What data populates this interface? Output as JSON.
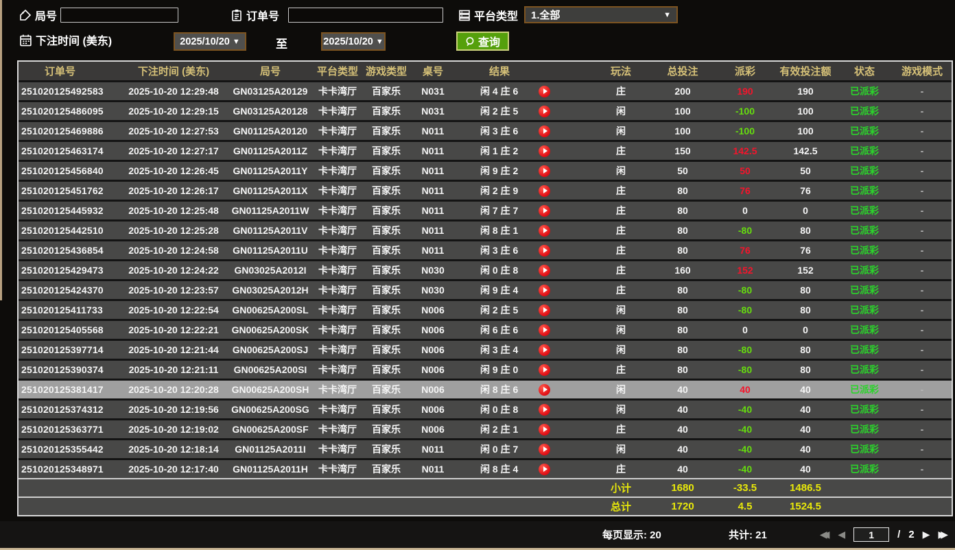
{
  "filters": {
    "round_label": "局号",
    "round_value": "",
    "order_label": "订单号",
    "order_value": "",
    "platform_label": "平台类型",
    "platform_value": "1.全部",
    "bet_time_label": "下注时间 (美东)",
    "date_from": "2025/10/20",
    "to_label": "至",
    "date_to": "2025/10/20",
    "query_label": "查询",
    "caret": "▼"
  },
  "table": {
    "columns": [
      "订单号",
      "下注时间 (美东)",
      "局号",
      "平台类型",
      "游戏类型",
      "桌号",
      "结果",
      "玩法",
      "总投注",
      "派彩",
      "有效投注额",
      "状态",
      "游戏模式"
    ],
    "selected_index": 15,
    "rows": [
      {
        "order": "251020125492583",
        "time": "2025-10-20 12:29:48",
        "round": "GN03125A20129",
        "platform": "卡卡湾厅",
        "game": "百家乐",
        "tbl": "N031",
        "result": "闲 4 庄 6",
        "side": "庄",
        "bet": "200",
        "payout": "190",
        "pc": "pos",
        "valid": "190",
        "status": "已派彩",
        "mode": "-"
      },
      {
        "order": "251020125486095",
        "time": "2025-10-20 12:29:15",
        "round": "GN03125A20128",
        "platform": "卡卡湾厅",
        "game": "百家乐",
        "tbl": "N031",
        "result": "闲 2 庄 5",
        "side": "闲",
        "bet": "100",
        "payout": "-100",
        "pc": "neg",
        "valid": "100",
        "status": "已派彩",
        "mode": "-"
      },
      {
        "order": "251020125469886",
        "time": "2025-10-20 12:27:53",
        "round": "GN01125A20120",
        "platform": "卡卡湾厅",
        "game": "百家乐",
        "tbl": "N011",
        "result": "闲 3 庄 6",
        "side": "闲",
        "bet": "100",
        "payout": "-100",
        "pc": "neg",
        "valid": "100",
        "status": "已派彩",
        "mode": "-"
      },
      {
        "order": "251020125463174",
        "time": "2025-10-20 12:27:17",
        "round": "GN01125A2011Z",
        "platform": "卡卡湾厅",
        "game": "百家乐",
        "tbl": "N011",
        "result": "闲 1 庄 2",
        "side": "庄",
        "bet": "150",
        "payout": "142.5",
        "pc": "pos",
        "valid": "142.5",
        "status": "已派彩",
        "mode": "-"
      },
      {
        "order": "251020125456840",
        "time": "2025-10-20 12:26:45",
        "round": "GN01125A2011Y",
        "platform": "卡卡湾厅",
        "game": "百家乐",
        "tbl": "N011",
        "result": "闲 9 庄 2",
        "side": "闲",
        "bet": "50",
        "payout": "50",
        "pc": "pos",
        "valid": "50",
        "status": "已派彩",
        "mode": "-"
      },
      {
        "order": "251020125451762",
        "time": "2025-10-20 12:26:17",
        "round": "GN01125A2011X",
        "platform": "卡卡湾厅",
        "game": "百家乐",
        "tbl": "N011",
        "result": "闲 2 庄 9",
        "side": "庄",
        "bet": "80",
        "payout": "76",
        "pc": "pos",
        "valid": "76",
        "status": "已派彩",
        "mode": "-"
      },
      {
        "order": "251020125445932",
        "time": "2025-10-20 12:25:48",
        "round": "GN01125A2011W",
        "platform": "卡卡湾厅",
        "game": "百家乐",
        "tbl": "N011",
        "result": "闲 7 庄 7",
        "side": "庄",
        "bet": "80",
        "payout": "0",
        "pc": "zero",
        "valid": "0",
        "status": "已派彩",
        "mode": "-"
      },
      {
        "order": "251020125442510",
        "time": "2025-10-20 12:25:28",
        "round": "GN01125A2011V",
        "platform": "卡卡湾厅",
        "game": "百家乐",
        "tbl": "N011",
        "result": "闲 8 庄 1",
        "side": "庄",
        "bet": "80",
        "payout": "-80",
        "pc": "neg",
        "valid": "80",
        "status": "已派彩",
        "mode": "-"
      },
      {
        "order": "251020125436854",
        "time": "2025-10-20 12:24:58",
        "round": "GN01125A2011U",
        "platform": "卡卡湾厅",
        "game": "百家乐",
        "tbl": "N011",
        "result": "闲 3 庄 6",
        "side": "庄",
        "bet": "80",
        "payout": "76",
        "pc": "pos",
        "valid": "76",
        "status": "已派彩",
        "mode": "-"
      },
      {
        "order": "251020125429473",
        "time": "2025-10-20 12:24:22",
        "round": "GN03025A2012I",
        "platform": "卡卡湾厅",
        "game": "百家乐",
        "tbl": "N030",
        "result": "闲 0 庄 8",
        "side": "庄",
        "bet": "160",
        "payout": "152",
        "pc": "pos",
        "valid": "152",
        "status": "已派彩",
        "mode": "-"
      },
      {
        "order": "251020125424370",
        "time": "2025-10-20 12:23:57",
        "round": "GN03025A2012H",
        "platform": "卡卡湾厅",
        "game": "百家乐",
        "tbl": "N030",
        "result": "闲 9 庄 4",
        "side": "庄",
        "bet": "80",
        "payout": "-80",
        "pc": "neg",
        "valid": "80",
        "status": "已派彩",
        "mode": "-"
      },
      {
        "order": "251020125411733",
        "time": "2025-10-20 12:22:54",
        "round": "GN00625A200SL",
        "platform": "卡卡湾厅",
        "game": "百家乐",
        "tbl": "N006",
        "result": "闲 2 庄 5",
        "side": "闲",
        "bet": "80",
        "payout": "-80",
        "pc": "neg",
        "valid": "80",
        "status": "已派彩",
        "mode": "-"
      },
      {
        "order": "251020125405568",
        "time": "2025-10-20 12:22:21",
        "round": "GN00625A200SK",
        "platform": "卡卡湾厅",
        "game": "百家乐",
        "tbl": "N006",
        "result": "闲 6 庄 6",
        "side": "闲",
        "bet": "80",
        "payout": "0",
        "pc": "zero",
        "valid": "0",
        "status": "已派彩",
        "mode": "-"
      },
      {
        "order": "251020125397714",
        "time": "2025-10-20 12:21:44",
        "round": "GN00625A200SJ",
        "platform": "卡卡湾厅",
        "game": "百家乐",
        "tbl": "N006",
        "result": "闲 3 庄 4",
        "side": "闲",
        "bet": "80",
        "payout": "-80",
        "pc": "neg",
        "valid": "80",
        "status": "已派彩",
        "mode": "-"
      },
      {
        "order": "251020125390374",
        "time": "2025-10-20 12:21:11",
        "round": "GN00625A200SI",
        "platform": "卡卡湾厅",
        "game": "百家乐",
        "tbl": "N006",
        "result": "闲 9 庄 0",
        "side": "庄",
        "bet": "80",
        "payout": "-80",
        "pc": "neg",
        "valid": "80",
        "status": "已派彩",
        "mode": "-"
      },
      {
        "order": "251020125381417",
        "time": "2025-10-20 12:20:28",
        "round": "GN00625A200SH",
        "platform": "卡卡湾厅",
        "game": "百家乐",
        "tbl": "N006",
        "result": "闲 8 庄 6",
        "side": "闲",
        "bet": "40",
        "payout": "40",
        "pc": "pos",
        "valid": "40",
        "status": "已派彩",
        "mode": "-"
      },
      {
        "order": "251020125374312",
        "time": "2025-10-20 12:19:56",
        "round": "GN00625A200SG",
        "platform": "卡卡湾厅",
        "game": "百家乐",
        "tbl": "N006",
        "result": "闲 0 庄 8",
        "side": "闲",
        "bet": "40",
        "payout": "-40",
        "pc": "neg",
        "valid": "40",
        "status": "已派彩",
        "mode": "-"
      },
      {
        "order": "251020125363771",
        "time": "2025-10-20 12:19:02",
        "round": "GN00625A200SF",
        "platform": "卡卡湾厅",
        "game": "百家乐",
        "tbl": "N006",
        "result": "闲 2 庄 1",
        "side": "庄",
        "bet": "40",
        "payout": "-40",
        "pc": "neg",
        "valid": "40",
        "status": "已派彩",
        "mode": "-"
      },
      {
        "order": "251020125355442",
        "time": "2025-10-20 12:18:14",
        "round": "GN01125A2011I",
        "platform": "卡卡湾厅",
        "game": "百家乐",
        "tbl": "N011",
        "result": "闲 0 庄 7",
        "side": "闲",
        "bet": "40",
        "payout": "-40",
        "pc": "neg",
        "valid": "40",
        "status": "已派彩",
        "mode": "-"
      },
      {
        "order": "251020125348971",
        "time": "2025-10-20 12:17:40",
        "round": "GN01125A2011H",
        "platform": "卡卡湾厅",
        "game": "百家乐",
        "tbl": "N011",
        "result": "闲 8 庄 4",
        "side": "庄",
        "bet": "40",
        "payout": "-40",
        "pc": "neg",
        "valid": "40",
        "status": "已派彩",
        "mode": "-"
      }
    ],
    "subtotal": {
      "label": "小计",
      "bet": "1680",
      "payout": "-33.5",
      "valid": "1486.5"
    },
    "total": {
      "label": "总计",
      "bet": "1720",
      "payout": "4.5",
      "valid": "1524.5"
    }
  },
  "footer": {
    "page_size_text": "每页显示: 20",
    "total_count_text": "共计: 21",
    "first_icon": "◀◀",
    "prev_icon": "◀",
    "current_page": "1",
    "divider": "/",
    "total_pages": "2",
    "next_icon": "▶",
    "last_icon": "▶▶"
  },
  "colors": {
    "header_gold": "#d6c178",
    "win_red": "#f5142b",
    "lose_green": "#66dd0e",
    "status_green": "#2bd42b",
    "summary_yellow": "#e8e80a",
    "query_green": "#55a00c",
    "control_border_brown": "#7d5420",
    "row_bg": "#484847",
    "selected_row_bg": "#9f9f9f"
  }
}
